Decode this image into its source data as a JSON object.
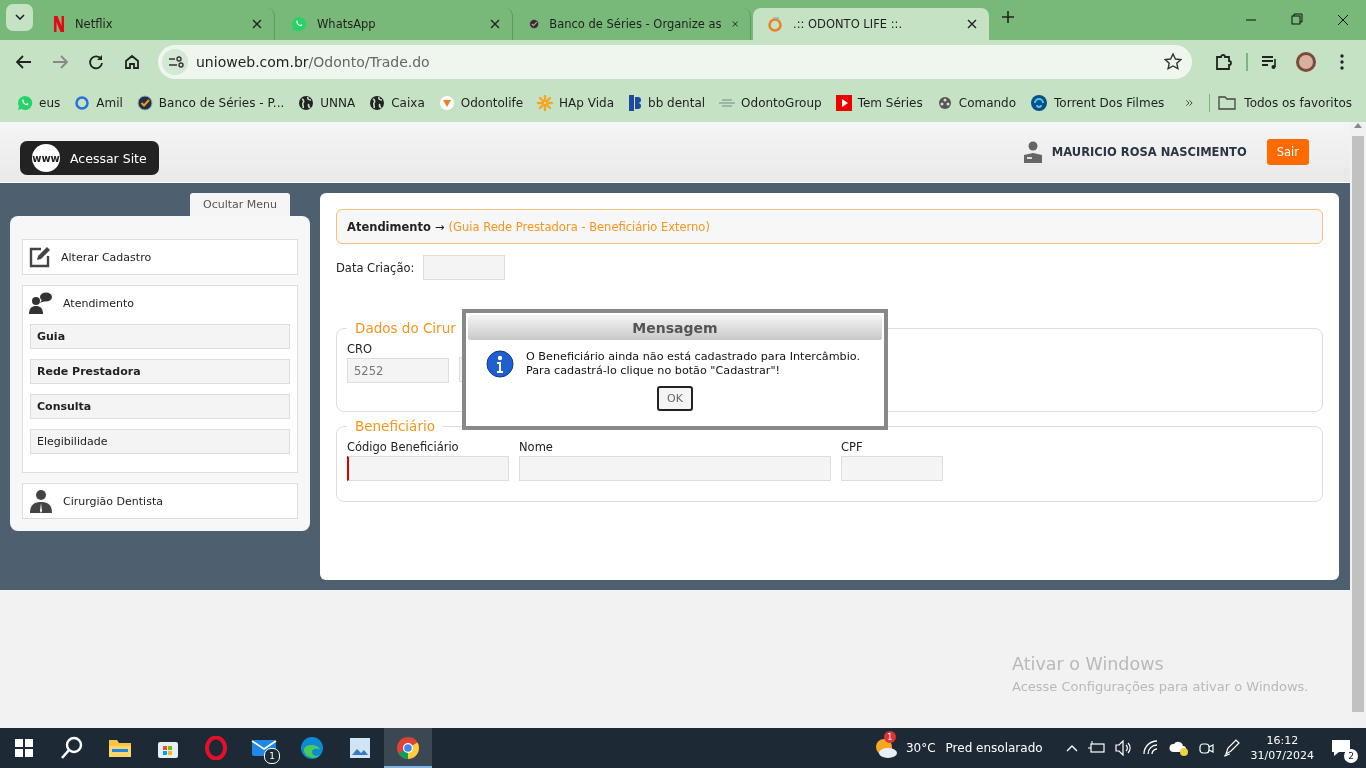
{
  "browser": {
    "tabs": [
      {
        "title": "Netflix",
        "selected": false
      },
      {
        "title": "WhatsApp",
        "selected": false
      },
      {
        "title": "Banco de Séries - Organize as",
        "selected": false
      },
      {
        "title": ".:: ODONTO LIFE ::.",
        "selected": true
      }
    ],
    "address": {
      "domain": "unioweb.com.br",
      "path": "/Odonto/Trade.do"
    },
    "bookmarks": [
      {
        "label": "eus"
      },
      {
        "label": "Amil"
      },
      {
        "label": "Banco de Séries - P..."
      },
      {
        "label": "UNNA"
      },
      {
        "label": "Caixa"
      },
      {
        "label": "Odontolife"
      },
      {
        "label": "HAp Vida"
      },
      {
        "label": "bb dental"
      },
      {
        "label": "OdontoGroup"
      },
      {
        "label": "Tem Séries"
      },
      {
        "label": "Comando"
      },
      {
        "label": "Torrent Dos Filmes"
      }
    ],
    "all_bookmarks": "Todos os favoritos"
  },
  "header": {
    "site_button": "Acessar Site",
    "site_badge": "www",
    "user": "MAURICIO ROSA NASCIMENTO",
    "logout": "Sair"
  },
  "sidebar": {
    "toggle": "Ocultar Menu",
    "items": [
      {
        "label": "Alterar Cadastro"
      },
      {
        "label": "Atendimento",
        "children": [
          {
            "label": "Guia",
            "emphasized": true
          },
          {
            "label": "Rede Prestadora",
            "emphasized": true
          },
          {
            "label": "Consulta",
            "emphasized": true
          },
          {
            "label": "Elegibilidade",
            "emphasized": false
          }
        ]
      },
      {
        "label": "Cirurgião Dentista"
      }
    ]
  },
  "content": {
    "breadcrumb": {
      "section": "Atendimento",
      "arrow": "→",
      "page": "(Guia Rede Prestadora - Beneficiário Externo)"
    },
    "created_label": "Data Criação:",
    "dentist": {
      "legend": "Dados do Cirur",
      "cro_label": "CRO",
      "cro_value": "5252"
    },
    "beneficiary": {
      "legend": "Beneficiário",
      "fields": [
        {
          "label": "Código Beneficiário",
          "invalid": true
        },
        {
          "label": "Nome",
          "invalid": false
        },
        {
          "label": "CPF",
          "invalid": false
        }
      ]
    }
  },
  "dialog": {
    "title": "Mensagem",
    "message": "O Beneficiário ainda não está cadastrado para Intercâmbio.\nPara cadastrá-lo clique no botão \"Cadastrar\"!",
    "button": "OK"
  },
  "windows_notice": {
    "title": "Ativar o Windows",
    "text": "Acesse Configurações para ativar o Windows."
  },
  "taskbar": {
    "apps": [
      {
        "kind": "explorer",
        "selected": false
      },
      {
        "kind": "store",
        "selected": false
      },
      {
        "kind": "opera",
        "selected": false
      },
      {
        "kind": "mail",
        "selected": false,
        "badge": "1"
      },
      {
        "kind": "edge",
        "selected": false
      },
      {
        "kind": "photos",
        "selected": false
      },
      {
        "kind": "chrome",
        "selected": true
      }
    ],
    "weather": {
      "badge": "1",
      "temp": "30°C",
      "text": "Pred ensolarado"
    },
    "clock": {
      "time": "16:12",
      "date": "31/07/2024"
    },
    "notifications": "2"
  }
}
